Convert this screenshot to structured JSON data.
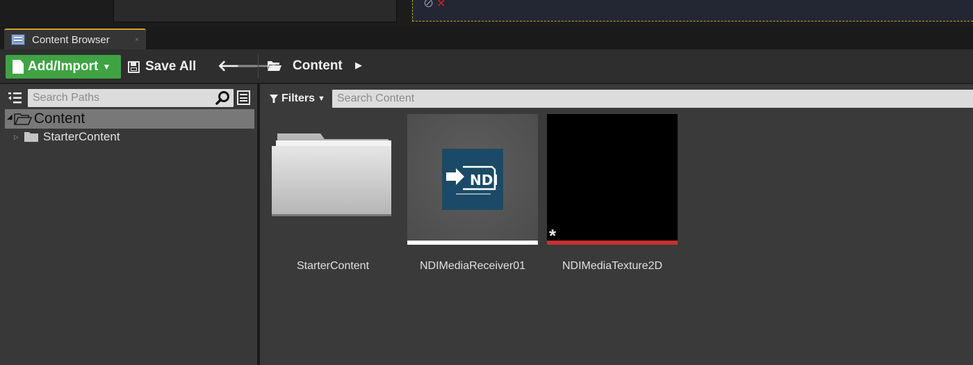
{
  "tab": {
    "title": "Content Browser",
    "close": "×"
  },
  "toolbar": {
    "add_import_label": "Add/Import",
    "save_all_label": "Save All",
    "back_icon": "arrow-left-icon",
    "forward_icon": "arrow-right-icon",
    "breadcrumb": {
      "label": "Content",
      "arrow": "▶"
    }
  },
  "sources": {
    "search_placeholder": "Search Paths",
    "tree": [
      {
        "label": "Content",
        "expanded": true,
        "selected": true
      },
      {
        "label": "StarterContent",
        "expanded": false,
        "selected": false
      }
    ]
  },
  "assets": {
    "filters_label": "Filters",
    "search_placeholder": "Search Content",
    "items": [
      {
        "name": "StarterContent",
        "type": "folder"
      },
      {
        "name": "NDIMediaReceiver01",
        "type": "ndi-media-receiver",
        "bar_color": "#ffffff"
      },
      {
        "name": "NDIMediaTexture2D",
        "type": "ndi-media-texture",
        "bar_color": "#c83030",
        "unsaved_marker": "*"
      }
    ]
  },
  "colors": {
    "accent_tab": "#c9a237",
    "add_button": "#3fa344",
    "tree_selected": "#787878",
    "ndi_logo_bg": "#1a4a67"
  },
  "ndi_logo_text": "NDI"
}
